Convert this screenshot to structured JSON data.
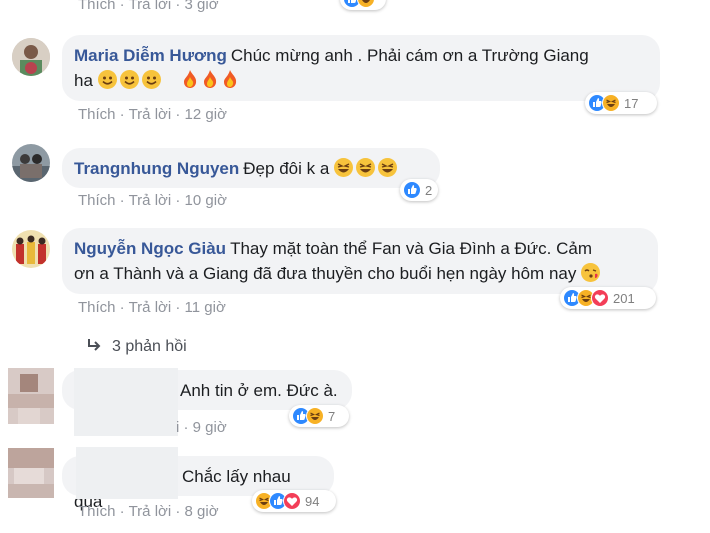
{
  "top_actions": {
    "like": "Thích",
    "reply": "Trả lời",
    "time": "3 giờ"
  },
  "comments": [
    {
      "author": "Maria Diễm Hương",
      "line1": "Chúc mừng anh . Phải cám ơn a Trường Giang",
      "line2": "ha",
      "like": "Thích",
      "reply": "Trả lời",
      "time": "12 giờ",
      "reactions": [
        "like",
        "haha"
      ],
      "count": "17"
    },
    {
      "author": "Trangnhung Nguyen",
      "text": "Đẹp đôi k a",
      "like": "Thích",
      "reply": "Trả lời",
      "time": "10 giờ",
      "reactions": [
        "like"
      ],
      "count": "2"
    },
    {
      "author": "Nguyễn Ngọc Giàu",
      "line1": "Thay mặt toàn thể Fan và Gia Đình a Đức. Cảm",
      "line2": "ơn a Thành và a Giang đã đưa thuyền cho buổi hẹn ngày hôm nay",
      "like": "Thích",
      "reply": "Trả lời",
      "time": "11 giờ",
      "reactions": [
        "like",
        "haha",
        "love"
      ],
      "count": "201"
    }
  ],
  "replies_link": "3 phản hồi",
  "replies": [
    {
      "text": "Anh tin ở em. Đức à.",
      "time_fragment": "i · 9 giờ",
      "reactions": [
        "like",
        "haha"
      ],
      "count": "7"
    },
    {
      "text": "Chắc lấy nhau quá",
      "like": "Thích",
      "reply": "Trả lời",
      "time": "8 giờ",
      "reactions": [
        "haha",
        "like",
        "love"
      ],
      "count": "94"
    }
  ],
  "colors": {
    "name": "#385898",
    "bubble": "#f2f3f5",
    "meta": "#90949c",
    "like": "#2e89ff",
    "haha": "#f7b125",
    "love": "#f33e58"
  }
}
